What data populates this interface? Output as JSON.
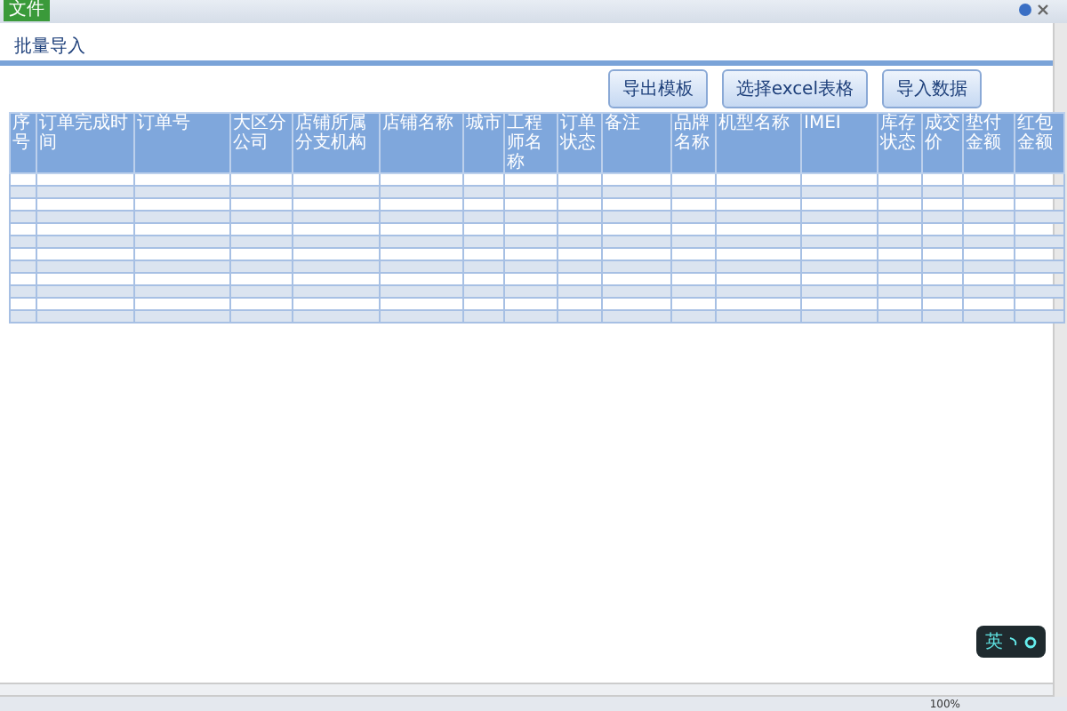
{
  "menu_tab": "文件",
  "page_title": "批量导入",
  "buttons": [
    "导出模板",
    "选择excel表格",
    "导入数据"
  ],
  "table": {
    "columns": [
      "序号",
      "订单完成时间",
      "订单号",
      "大区分公司",
      "店铺所属分支机构",
      "店铺名称",
      "城市",
      "工程师名称",
      "订单状态",
      "备注",
      "品牌名称",
      "机型名称",
      "IMEI",
      "库存状态",
      "成交价",
      "垫付金额",
      "红包金额"
    ]
  },
  "ime_toolbar": {
    "label": "英"
  },
  "status_bar": {
    "zoom": "100%"
  }
}
